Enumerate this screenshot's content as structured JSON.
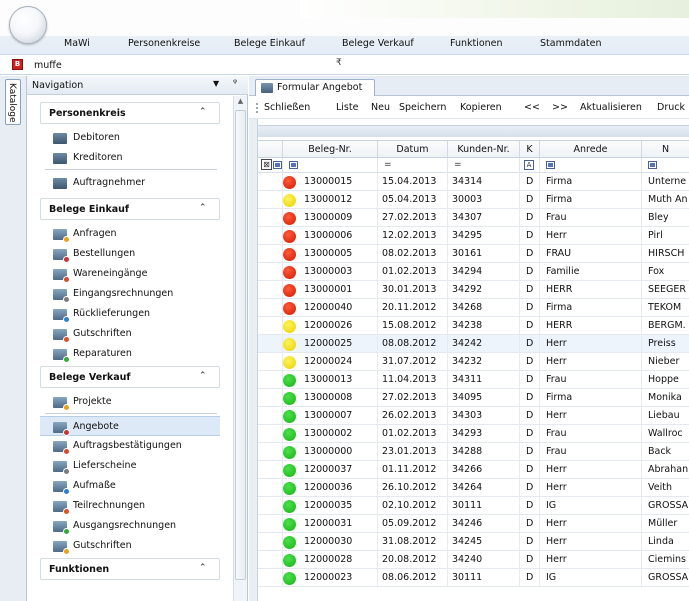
{
  "menu": {
    "items": [
      "MaWi",
      "Personenkreise",
      "Belege Einkauf",
      "Belege Verkauf",
      "Funktionen",
      "Stammdaten"
    ]
  },
  "address": {
    "value": "muffe",
    "dropdown_glyph": "₹"
  },
  "rail": {
    "katalog": "Kataloge"
  },
  "nav": {
    "title": "Navigation",
    "groups": [
      {
        "title": "Personenkreis",
        "items": [
          "Debitoren",
          "Kreditoren",
          "Auftragnehmer"
        ]
      },
      {
        "title": "Belege Einkauf",
        "items": [
          "Anfragen",
          "Bestellungen",
          "Wareneingänge",
          "Eingangsrechnungen",
          "Rücklieferungen",
          "Gutschriften",
          "Reparaturen"
        ]
      },
      {
        "title": "Belege Verkauf",
        "items": [
          "Projekte",
          "Angebote",
          "Auftragsbestätigungen",
          "Lieferscheine",
          "Aufmaße",
          "Teilrechnungen",
          "Ausgangsrechnungen",
          "Gutschriften"
        ]
      },
      {
        "title": "Funktionen",
        "items": []
      }
    ],
    "selected": "Angebote"
  },
  "doc": {
    "tab": "Formular Angebot"
  },
  "toolbar": {
    "buttons": [
      "Schließen",
      "Liste",
      "Neu",
      "Speichern",
      "Kopieren",
      "<<",
      ">>",
      "Aktualisieren",
      "Druck"
    ]
  },
  "grid": {
    "columns": [
      "Beleg-Nr.",
      "Datum",
      "Kunden-Nr.",
      "K",
      "Anrede",
      "N"
    ],
    "filter": [
      "=",
      "=",
      "A"
    ],
    "rows": [
      {
        "status": "red",
        "nr": "13000015",
        "datum": "15.04.2013",
        "kunde": "34314",
        "k": "D",
        "anrede": "Firma",
        "name": "Unterne"
      },
      {
        "status": "yellow",
        "nr": "13000012",
        "datum": "05.04.2013",
        "kunde": "30003",
        "k": "D",
        "anrede": "Firma",
        "name": "Muth An"
      },
      {
        "status": "red",
        "nr": "13000009",
        "datum": "27.02.2013",
        "kunde": "34307",
        "k": "D",
        "anrede": "Frau",
        "name": "Bley"
      },
      {
        "status": "red",
        "nr": "13000006",
        "datum": "12.02.2013",
        "kunde": "34295",
        "k": "D",
        "anrede": "Herr",
        "name": "Pirl"
      },
      {
        "status": "red",
        "nr": "13000005",
        "datum": "08.02.2013",
        "kunde": "30161",
        "k": "D",
        "anrede": "FRAU",
        "name": "HIRSCH"
      },
      {
        "status": "red",
        "nr": "13000003",
        "datum": "01.02.2013",
        "kunde": "34294",
        "k": "D",
        "anrede": "Familie",
        "name": "Fox"
      },
      {
        "status": "red",
        "nr": "13000001",
        "datum": "30.01.2013",
        "kunde": "34292",
        "k": "D",
        "anrede": "HERR",
        "name": "SEEGER"
      },
      {
        "status": "red",
        "nr": "12000040",
        "datum": "20.11.2012",
        "kunde": "34268",
        "k": "D",
        "anrede": "Firma",
        "name": "TEKOM"
      },
      {
        "status": "yellow",
        "nr": "12000026",
        "datum": "15.08.2012",
        "kunde": "34238",
        "k": "D",
        "anrede": "HERR",
        "name": "BERGM."
      },
      {
        "status": "yellow",
        "nr": "12000025",
        "datum": "08.08.2012",
        "kunde": "34242",
        "k": "D",
        "anrede": "Herr",
        "name": "Preiss"
      },
      {
        "status": "yellow",
        "nr": "12000024",
        "datum": "31.07.2012",
        "kunde": "34232",
        "k": "D",
        "anrede": "Herr",
        "name": "Nieber"
      },
      {
        "status": "green",
        "nr": "13000013",
        "datum": "11.04.2013",
        "kunde": "34311",
        "k": "D",
        "anrede": "Frau",
        "name": "Hoppe"
      },
      {
        "status": "green",
        "nr": "13000008",
        "datum": "27.02.2013",
        "kunde": "34095",
        "k": "D",
        "anrede": "Firma",
        "name": "Monika"
      },
      {
        "status": "green",
        "nr": "13000007",
        "datum": "26.02.2013",
        "kunde": "34303",
        "k": "D",
        "anrede": "Herr",
        "name": "Liebau"
      },
      {
        "status": "green",
        "nr": "13000002",
        "datum": "01.02.2013",
        "kunde": "34293",
        "k": "D",
        "anrede": "Frau",
        "name": "Wallroc"
      },
      {
        "status": "green",
        "nr": "13000000",
        "datum": "23.01.2013",
        "kunde": "34288",
        "k": "D",
        "anrede": "Frau",
        "name": "Back"
      },
      {
        "status": "green",
        "nr": "12000037",
        "datum": "01.11.2012",
        "kunde": "34266",
        "k": "D",
        "anrede": "Herr",
        "name": "Abrahan"
      },
      {
        "status": "green",
        "nr": "12000036",
        "datum": "26.10.2012",
        "kunde": "34264",
        "k": "D",
        "anrede": "Herr",
        "name": "Veith"
      },
      {
        "status": "green",
        "nr": "12000035",
        "datum": "02.10.2012",
        "kunde": "30111",
        "k": "D",
        "anrede": "IG",
        "name": "GROSSA"
      },
      {
        "status": "green",
        "nr": "12000031",
        "datum": "05.09.2012",
        "kunde": "34246",
        "k": "D",
        "anrede": "Herr",
        "name": "Müller"
      },
      {
        "status": "green",
        "nr": "12000030",
        "datum": "31.08.2012",
        "kunde": "34245",
        "k": "D",
        "anrede": "Herr",
        "name": "Linda"
      },
      {
        "status": "green",
        "nr": "12000028",
        "datum": "20.08.2012",
        "kunde": "34240",
        "k": "D",
        "anrede": "Herr",
        "name": "Ciemins"
      },
      {
        "status": "green",
        "nr": "12000023",
        "datum": "08.06.2012",
        "kunde": "30111",
        "k": "D",
        "anrede": "IG",
        "name": "GROSSA"
      }
    ],
    "highlighted_row": "12000025"
  }
}
